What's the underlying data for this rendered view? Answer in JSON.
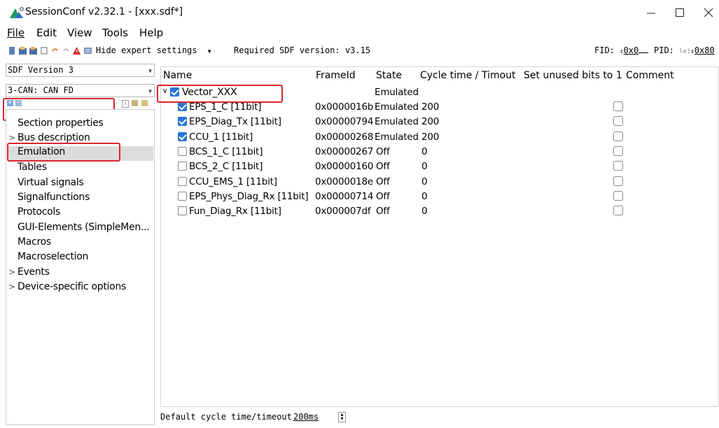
{
  "window": {
    "title": "SessionConf v2.32.1 - [xxx.sdf*]",
    "controls": {
      "minimize": "—",
      "maximize": "☐",
      "close": "✕"
    }
  },
  "menu": [
    {
      "label": "File"
    },
    {
      "label": "Edit"
    },
    {
      "label": "View"
    },
    {
      "label": "Tools"
    },
    {
      "label": "Help"
    }
  ],
  "toolbar": {
    "expert_dropdown": "Hide expert settings",
    "required_sdf": "Required SDF version: v3.15",
    "fid_label": "FID:",
    "fid_value": "0x0",
    "pid_label": "PID:",
    "pid_prefix": "le)",
    "pid_value": "0x80"
  },
  "left_panel": {
    "sdf_version": "SDF Version 3",
    "bus_combo": "3-CAN: CAN FD",
    "nav_items": [
      {
        "label": "Section properties",
        "expandable": false
      },
      {
        "label": "Bus description",
        "expandable": true
      },
      {
        "label": "Emulation",
        "expandable": false,
        "selected": true
      },
      {
        "label": "Tables",
        "expandable": false
      },
      {
        "label": "Virtual signals",
        "expandable": false
      },
      {
        "label": "Signalfunctions",
        "expandable": false
      },
      {
        "label": "Protocols",
        "expandable": false
      },
      {
        "label": "GUI-Elements (SimpleMen...",
        "expandable": false
      },
      {
        "label": "Macros",
        "expandable": false
      },
      {
        "label": "Macroselection",
        "expandable": false
      },
      {
        "label": "Events",
        "expandable": true
      },
      {
        "label": "Device-specific options",
        "expandable": true
      }
    ]
  },
  "table": {
    "headers": {
      "name": "Name",
      "frame_id": "FrameId",
      "state": "State",
      "cycle": "Cycle time / Timout",
      "unused": "Set unused bits to 1",
      "comment": "Comment"
    },
    "root": {
      "name": "Vector_XXX",
      "state": "Emulated",
      "checked": true
    },
    "rows": [
      {
        "name": "EPS_1_C [11bit]",
        "frame_id": "0x0000016b",
        "state": "Emulated",
        "cycle": "200",
        "checked": true
      },
      {
        "name": "EPS_Diag_Tx [11bit]",
        "frame_id": "0x00000794",
        "state": "Emulated",
        "cycle": "200",
        "checked": true
      },
      {
        "name": "CCU_1 [11bit]",
        "frame_id": "0x00000268",
        "state": "Emulated",
        "cycle": "200",
        "checked": true
      },
      {
        "name": "BCS_1_C [11bit]",
        "frame_id": "0x00000267",
        "state": "Off",
        "cycle": "0",
        "checked": false
      },
      {
        "name": "BCS_2_C [11bit]",
        "frame_id": "0x00000160",
        "state": "Off",
        "cycle": "0",
        "checked": false
      },
      {
        "name": "CCU_EMS_1 [11bit]",
        "frame_id": "0x0000018e",
        "state": "Off",
        "cycle": "0",
        "checked": false
      },
      {
        "name": "EPS_Phys_Diag_Rx [11bit]",
        "frame_id": "0x00000714",
        "state": "Off",
        "cycle": "0",
        "checked": false
      },
      {
        "name": "Fun_Diag_Rx [11bit]",
        "frame_id": "0x000007df",
        "state": "Off",
        "cycle": "0",
        "checked": false
      }
    ]
  },
  "footer": {
    "label": "Default cycle time/timeout",
    "value": "200ms"
  },
  "colors": {
    "highlight_red": "#d9262c",
    "check_blue": "#2b74d6",
    "selected_bg": "#dcdcdc",
    "logo_green": "#1e9a5a"
  }
}
